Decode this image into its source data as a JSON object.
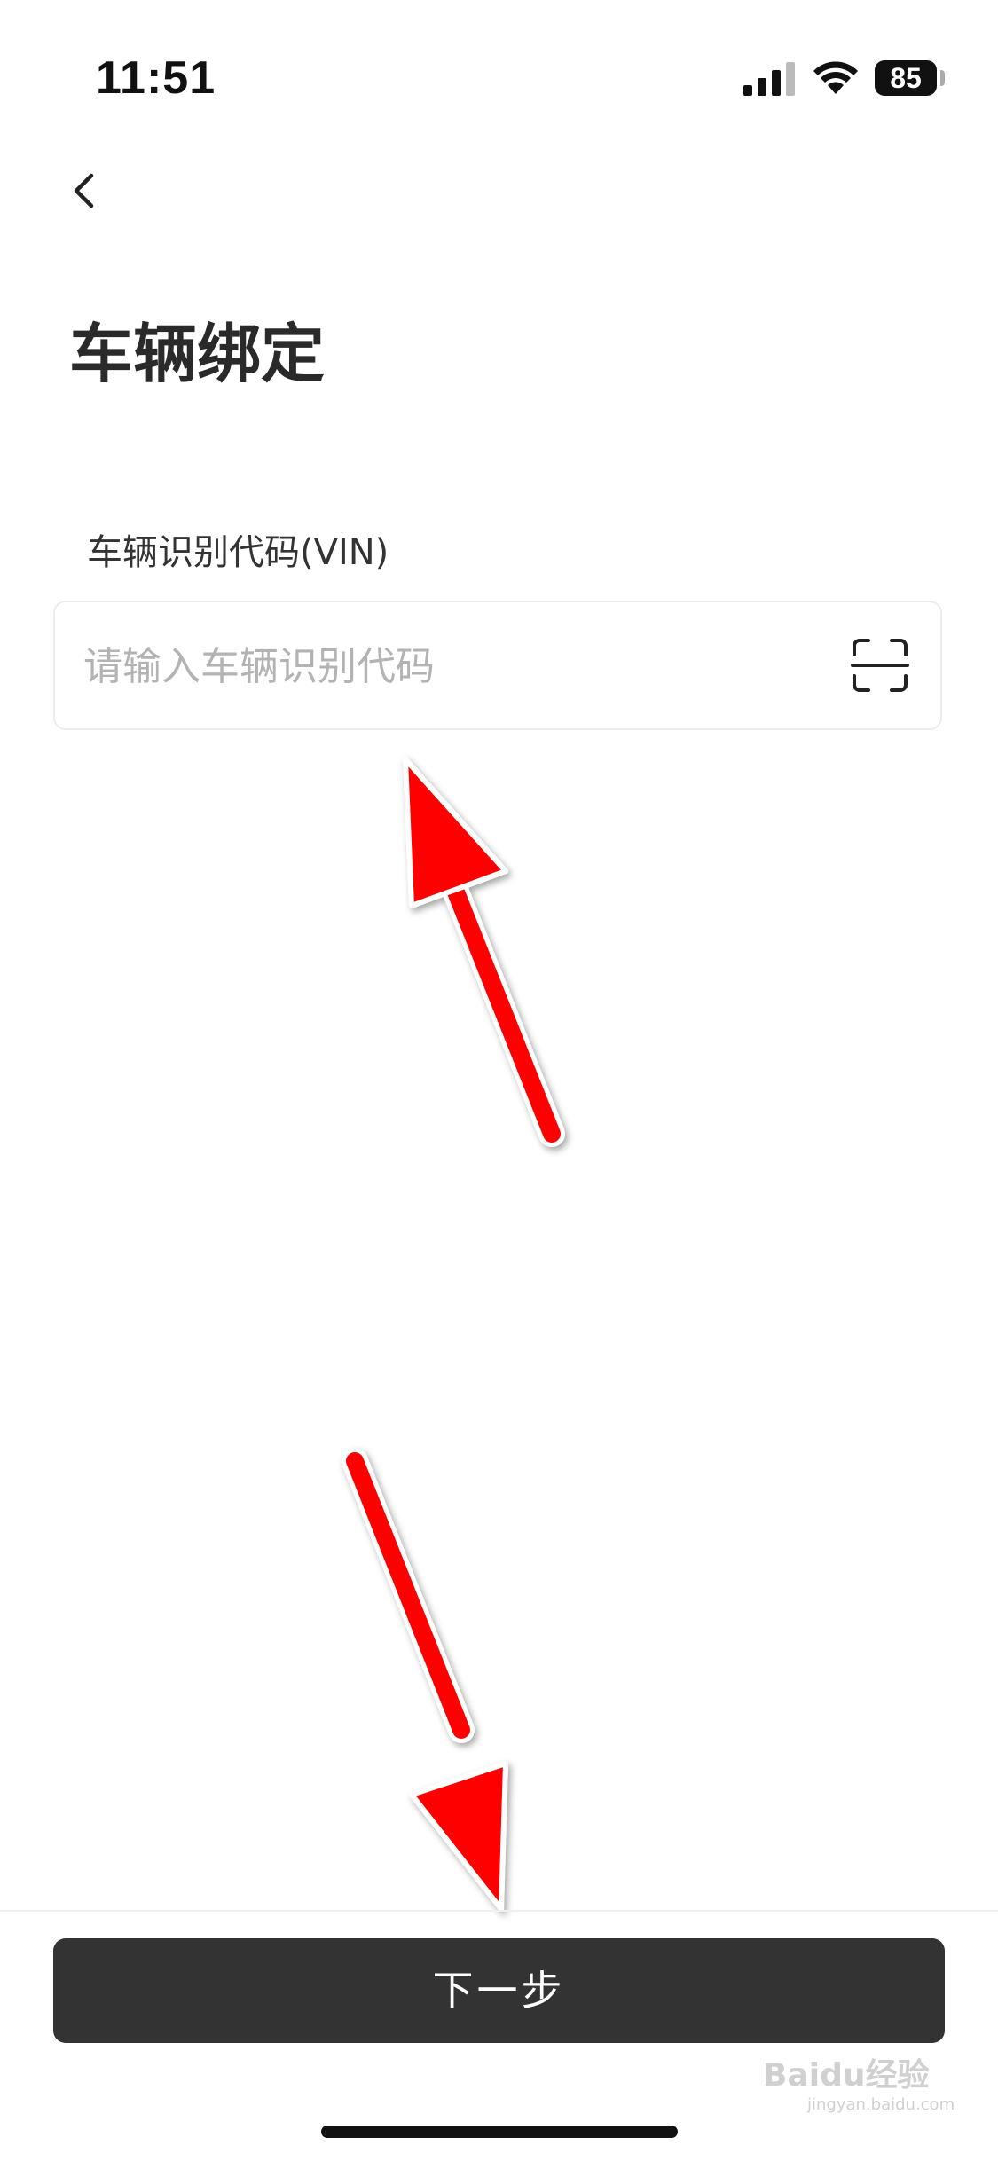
{
  "status_bar": {
    "time": "11:51",
    "battery": "85",
    "icons": [
      "signal-icon",
      "wifi-icon",
      "battery-icon"
    ]
  },
  "nav": {
    "back_icon": "chevron-left-icon"
  },
  "page": {
    "title": "车辆绑定"
  },
  "vin_field": {
    "label": "车辆识别代码(VIN)",
    "value": "",
    "placeholder": "请输入车辆识别代码",
    "scan_icon": "scan-icon"
  },
  "footer": {
    "next_label": "下一步"
  },
  "annotations": {
    "arrow_color": "#ff0000"
  },
  "watermark": {
    "text": "Baidu经验",
    "sub": "jingyan.baidu.com"
  },
  "colors": {
    "button_bg": "#333333",
    "placeholder": "#b3b3b3"
  }
}
